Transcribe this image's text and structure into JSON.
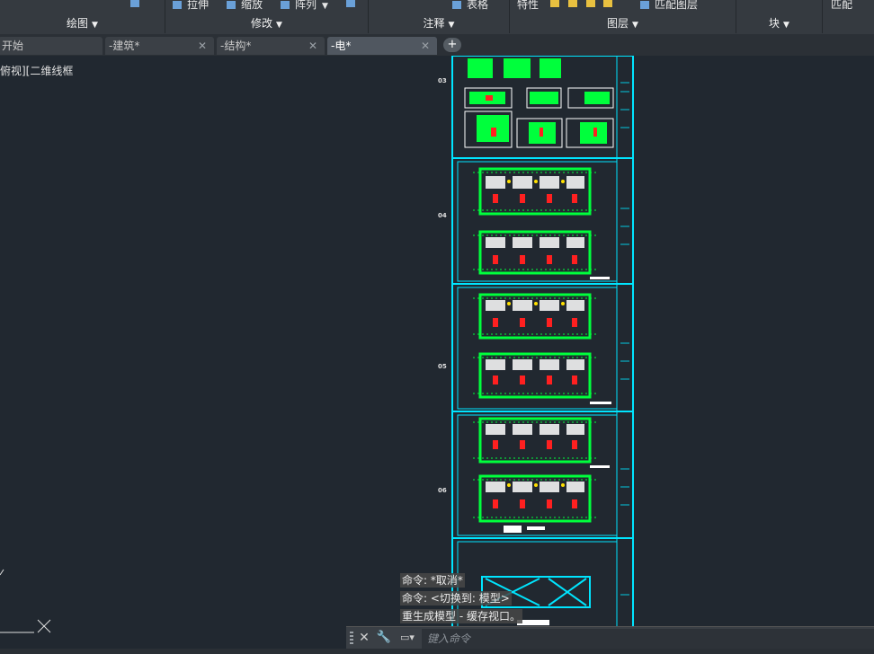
{
  "ribbon": {
    "tools_row": {
      "stretch": "拉伸",
      "scale": "缩放",
      "array": "阵列",
      "table": "表格",
      "properties": "特性",
      "match_layer": "匹配图层",
      "match": "匹配"
    },
    "panels": [
      "绘图",
      "修改",
      "注释",
      "图层",
      "块"
    ]
  },
  "tabs": [
    {
      "label": "开始",
      "active": false
    },
    {
      "label": "-建筑*",
      "active": false
    },
    {
      "label": "-结构*",
      "active": false
    },
    {
      "label": "-电*",
      "active": true
    }
  ],
  "viewport_label": "俯视][二维线框",
  "sheet_numbers": [
    "03",
    "04",
    "05",
    "06"
  ],
  "command": {
    "history": [
      "命令: *取消*",
      "命令:  <切换到: 模型>",
      "重生成模型 - 缓存视口。"
    ],
    "placeholder": "键入命令"
  },
  "colors": {
    "background": "#212830",
    "frame": "#00e5ff",
    "plan": "#00ff3c",
    "accent": "#ff2020",
    "highlight": "#ffe000"
  }
}
